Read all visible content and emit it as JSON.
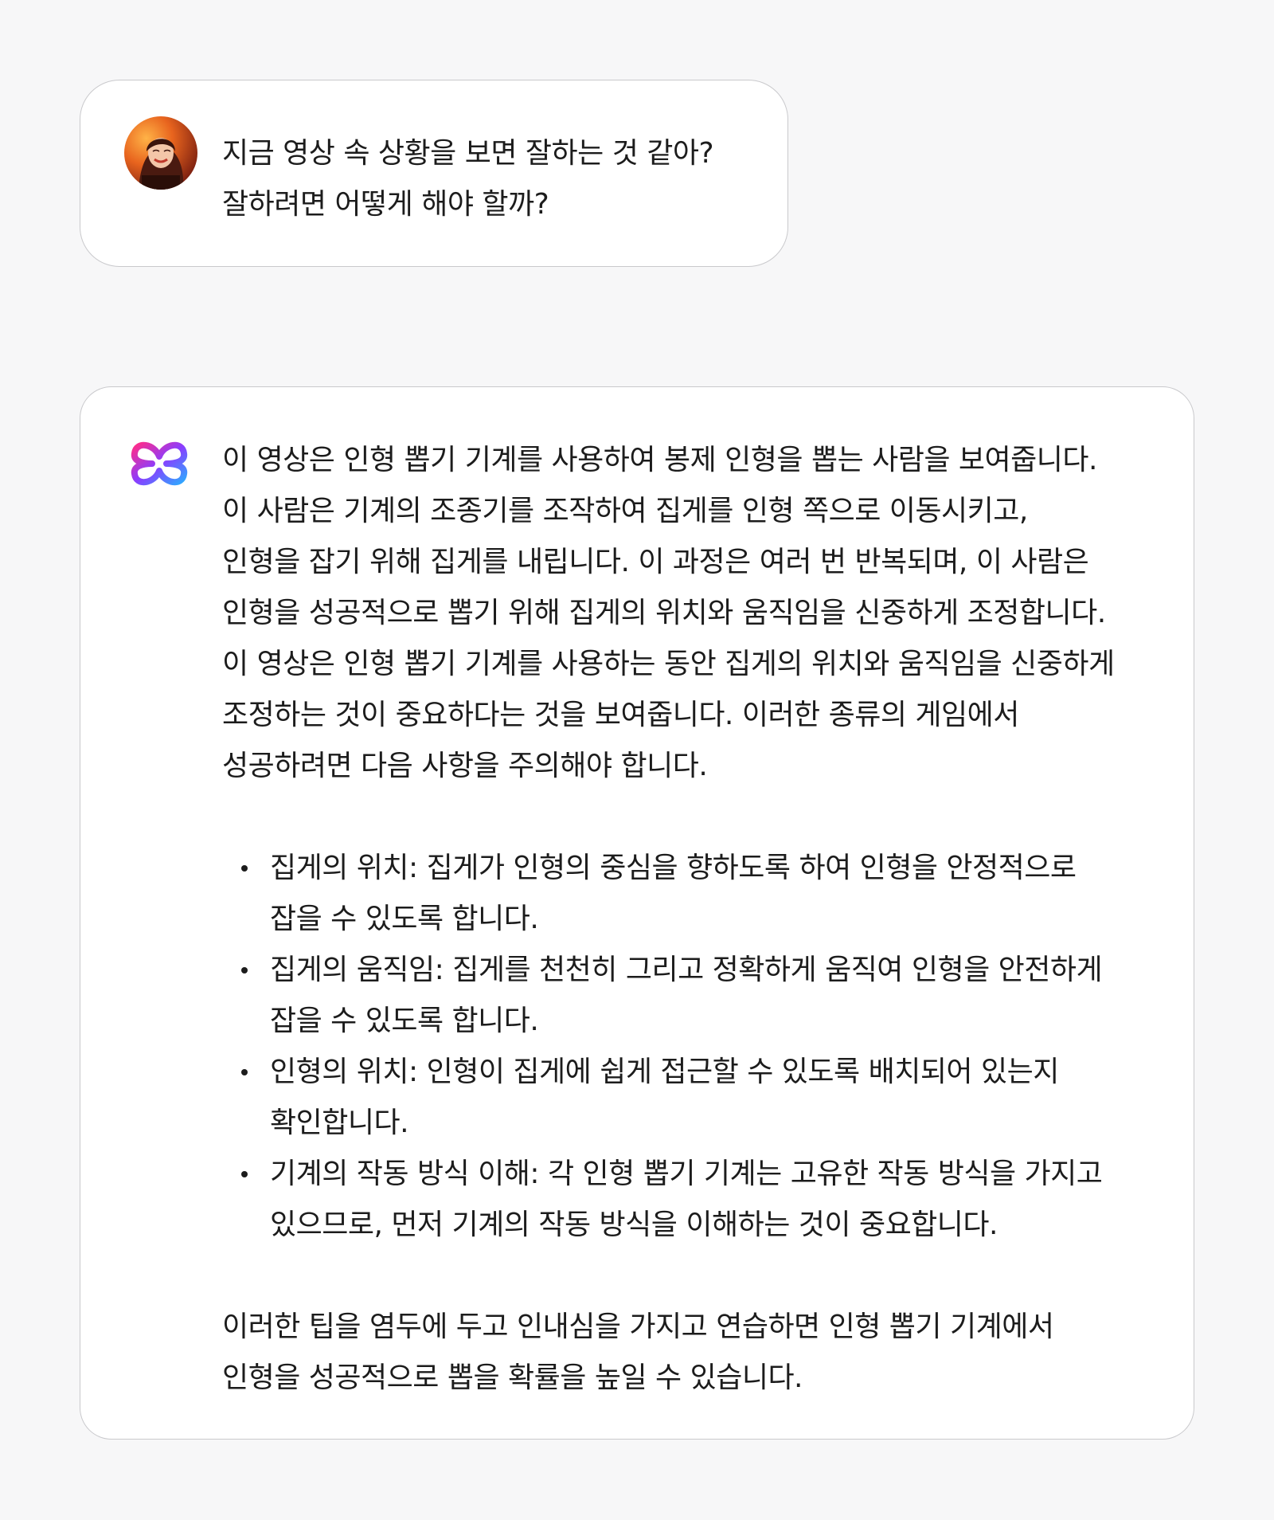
{
  "user_message": {
    "lines": [
      "지금 영상 속 상황을 보면 잘하는 것 같아?",
      "잘하려면 어떻게 해야 할까?"
    ]
  },
  "ai_message": {
    "intro_lines": [
      "이 영상은 인형 뽑기 기계를 사용하여 봉제 인형을 뽑는 사람을 보여줍니다.",
      "이 사람은 기계의 조종기를 조작하여 집게를 인형 쪽으로 이동시키고,",
      "인형을 잡기 위해 집게를 내립니다. 이 과정은 여러 번 반복되며, 이 사람은",
      "인형을 성공적으로 뽑기 위해 집게의 위치와 움직임을 신중하게 조정합니다.",
      "이 영상은 인형 뽑기 기계를 사용하는 동안 집게의 위치와 움직임을 신중하게",
      "조정하는 것이 중요하다는 것을 보여줍니다. 이러한 종류의 게임에서",
      "성공하려면 다음 사항을 주의해야 합니다."
    ],
    "bullets": [
      {
        "line1": "집게의 위치: 집게가 인형의 중심을 향하도록 하여 인형을 안정적으로",
        "line2": "잡을 수 있도록 합니다."
      },
      {
        "line1": "집게의 움직임: 집게를 천천히 그리고 정확하게 움직여 인형을 안전하게",
        "line2": "잡을 수 있도록 합니다."
      },
      {
        "line1": "인형의 위치: 인형이 집게에 쉽게 접근할 수 있도록 배치되어 있는지",
        "line2": "확인합니다."
      },
      {
        "line1": "기계의 작동 방식 이해: 각 인형 뽑기 기계는 고유한 작동 방식을 가지고",
        "line2": "있으므로, 먼저 기계의 작동 방식을 이해하는 것이 중요합니다."
      }
    ],
    "outro_lines": [
      "이러한 팁을 염두에 두고 인내심을 가지고 연습하면 인형 뽑기 기계에서",
      "인형을 성공적으로 뽑을 확률을 높일 수 있습니다."
    ]
  },
  "icons": {
    "user_avatar": "user-avatar-photo",
    "assistant_logo": "assistant-logo-icon"
  },
  "colors": {
    "background": "#f7f7f8",
    "card": "#ffffff",
    "card_border": "#c9c9cc",
    "text": "#1c1c1c",
    "logo_gradient": [
      "#ff2d8a",
      "#8a3dff",
      "#2fa8ff"
    ]
  }
}
